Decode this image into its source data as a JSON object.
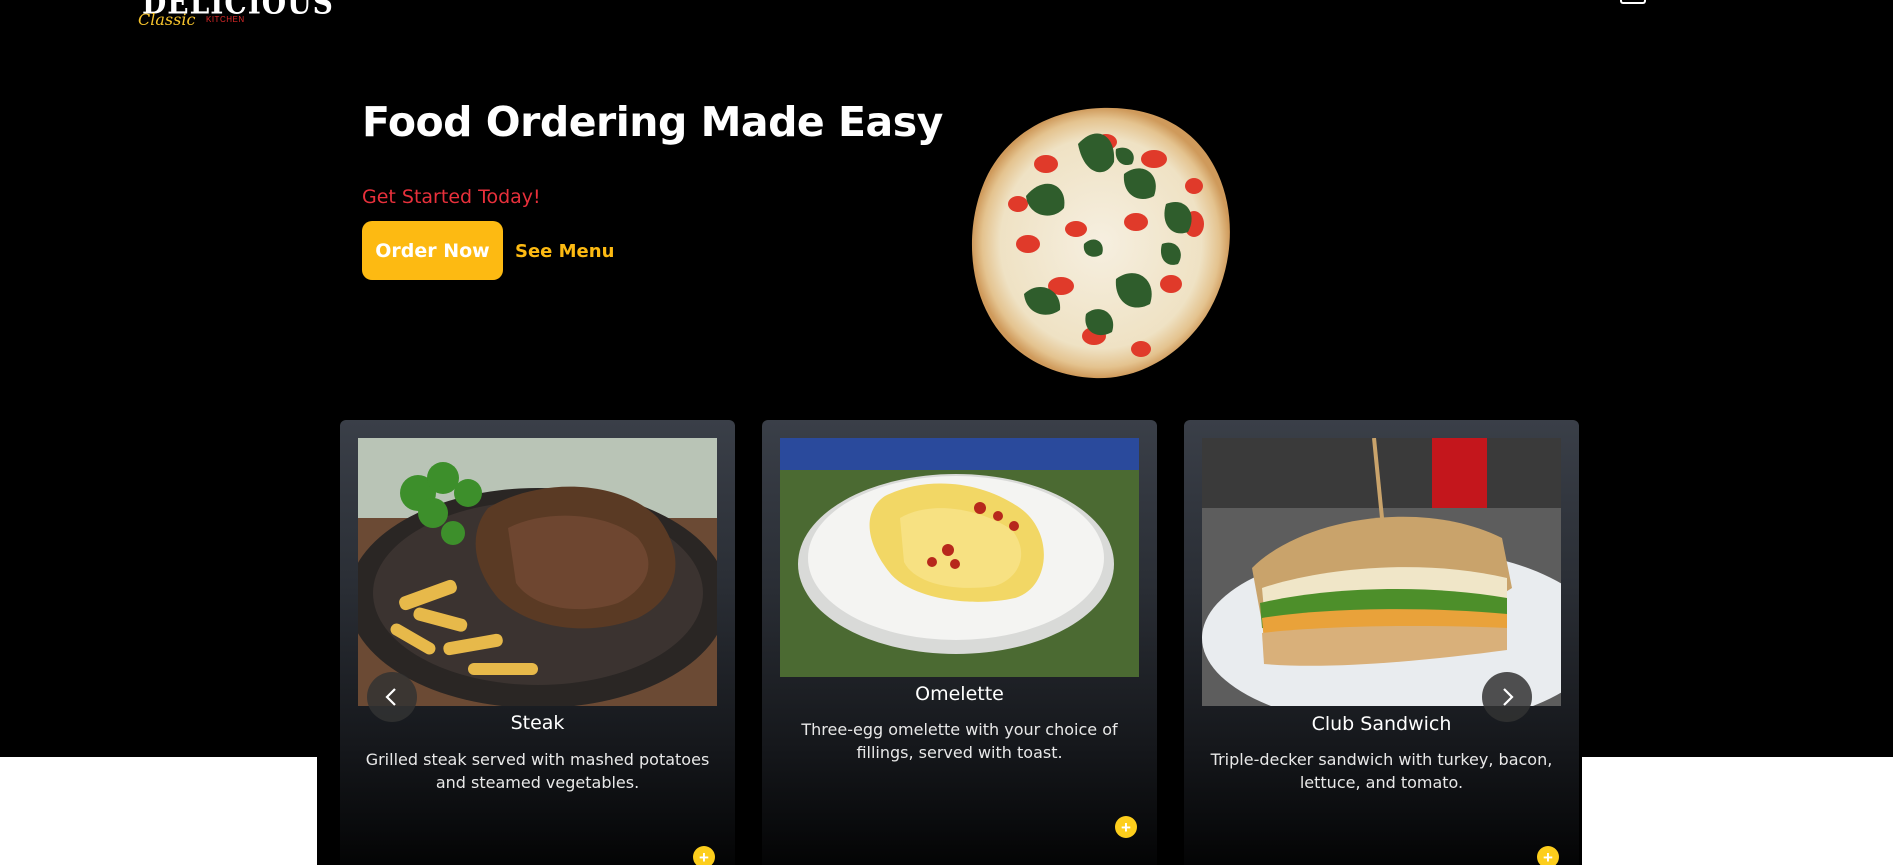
{
  "header": {
    "logo": {
      "word": "DELICIOUS",
      "script": "Classic",
      "sub": "KITCHEN"
    },
    "cart_icon": "shopping-cart-icon"
  },
  "hero": {
    "title": "Food Ordering Made Easy",
    "subtitle": "Get Started Today!",
    "order_button": "Order Now",
    "menu_link": "See Menu",
    "image": "margherita-pizza"
  },
  "carousel": {
    "prev_icon": "chevron-left-icon",
    "next_icon": "chevron-right-icon",
    "items": [
      {
        "name": "Steak",
        "description": "Grilled steak served with mashed potatoes and steamed vegetables.",
        "image": "steak-plate",
        "add_label": "+"
      },
      {
        "name": "Omelette",
        "description": "Three-egg omelette with your choice of fillings, served with toast.",
        "image": "omelette-plate",
        "add_label": "+"
      },
      {
        "name": "Club Sandwich",
        "description": "Triple-decker sandwich with turkey, bacon, lettuce, and tomato.",
        "image": "club-sandwich-plate",
        "add_label": "+"
      }
    ]
  },
  "colors": {
    "accent": "#fdba12",
    "subtitle_red": "#e8303b",
    "background": "#000000"
  }
}
